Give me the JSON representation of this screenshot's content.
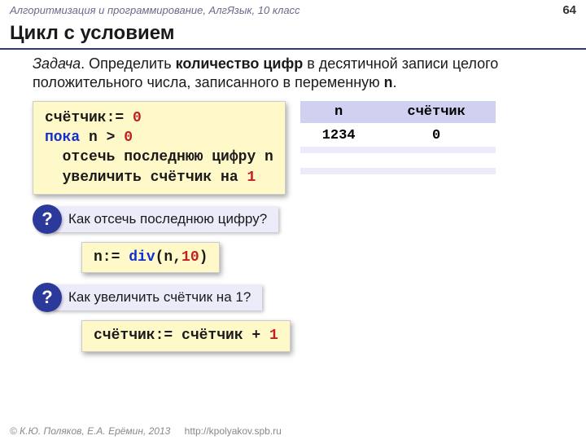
{
  "header": {
    "course": "Алгоритмизация и программирование, АлгЯзык, 10 класс",
    "page_number": "64"
  },
  "title": "Цикл с условием",
  "task": {
    "label": "Задача",
    "text_before_bold": ". Определить ",
    "bold": "количество цифр",
    "text_after_bold": " в десятичной записи целого положительного числа, записанного в переменную ",
    "var": "n",
    "period": "."
  },
  "code_main": {
    "l1_a": "счётчик:= ",
    "l1_b": "0",
    "l2_a": "пока",
    "l2_b": " n > ",
    "l2_c": "0",
    "l3": "  отсечь последнюю цифру n",
    "l4_a": "  увеличить счётчик на ",
    "l4_b": "1"
  },
  "trace": {
    "head_n": "n",
    "head_c": "счётчик",
    "r1_n": "1234",
    "r1_c": "0",
    "r2_n": "",
    "r2_c": "",
    "r3_n": "",
    "r3_c": ""
  },
  "q1": {
    "badge": "?",
    "text": "Как отсечь последнюю цифру?"
  },
  "ans1": {
    "a": "n:= ",
    "b": "div",
    "c": "(n,",
    "d": "10",
    "e": ")"
  },
  "q2": {
    "badge": "?",
    "text": "Как увеличить счётчик на 1?"
  },
  "ans2": {
    "a": "счётчик:= счётчик + ",
    "b": "1"
  },
  "footer": {
    "copyright": "© К.Ю. Поляков, Е.А. Ерёмин, 2013",
    "url": "http://kpolyakov.spb.ru"
  }
}
